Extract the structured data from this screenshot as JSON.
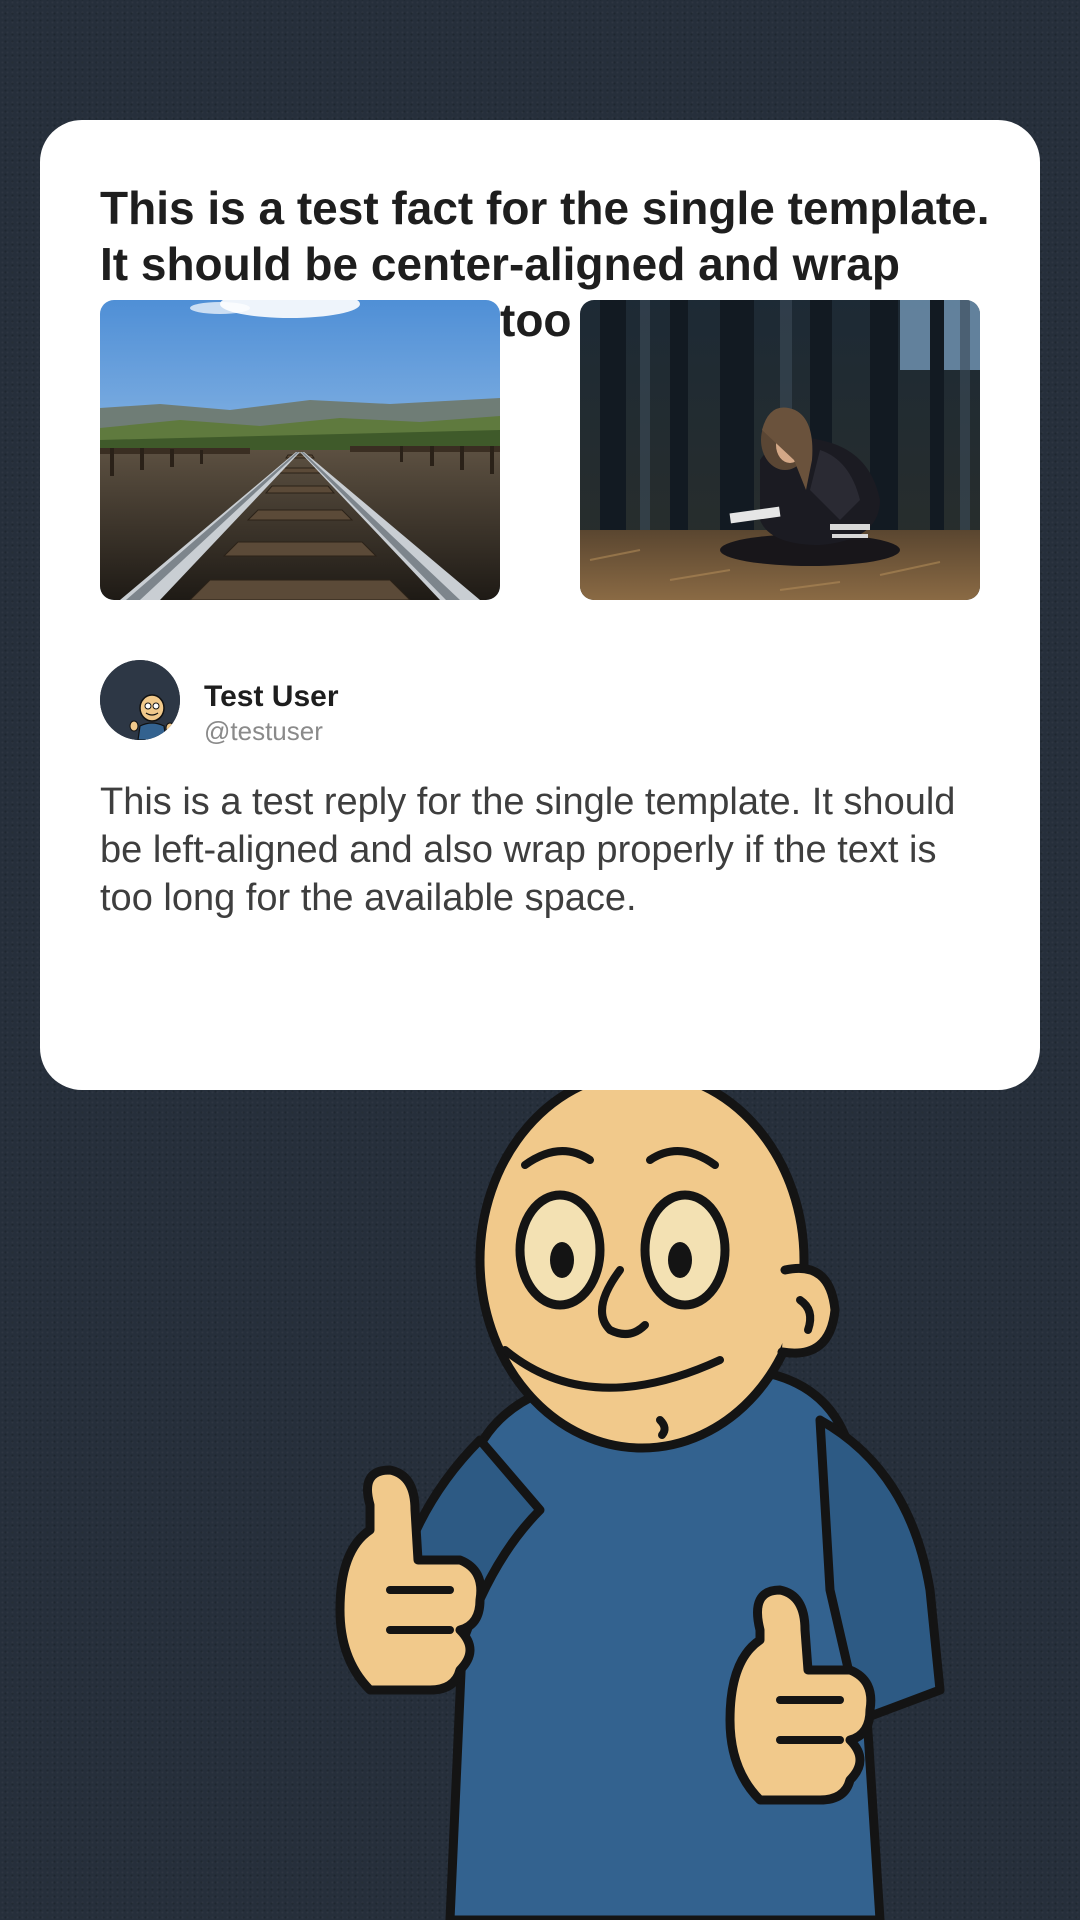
{
  "fact": {
    "line1": "This is a test fact for the single template.",
    "line2": "It should be center-aligned and wrap",
    "line3": "too"
  },
  "images": [
    {
      "subject": "railroad-tracks-photo"
    },
    {
      "subject": "person-reading-in-forest-photo"
    }
  ],
  "reply": {
    "user_name": "Test User",
    "user_handle": "@testuser",
    "text": "This is a test reply for the single template. It should be left-aligned and also wrap properly if the text is too long for the available space."
  },
  "colors": {
    "background": "#262f3b",
    "card": "#ffffff",
    "title_text": "#1e1e1e",
    "handle_text": "#8a8a8a",
    "reply_text": "#3e3e3e",
    "mascot_skin": "#f1c98b",
    "mascot_shirt": "#33628f"
  },
  "icons": {
    "avatar": "thumbs-up-mascot-avatar",
    "mascot": "thumbs-up-mascot-icon"
  }
}
